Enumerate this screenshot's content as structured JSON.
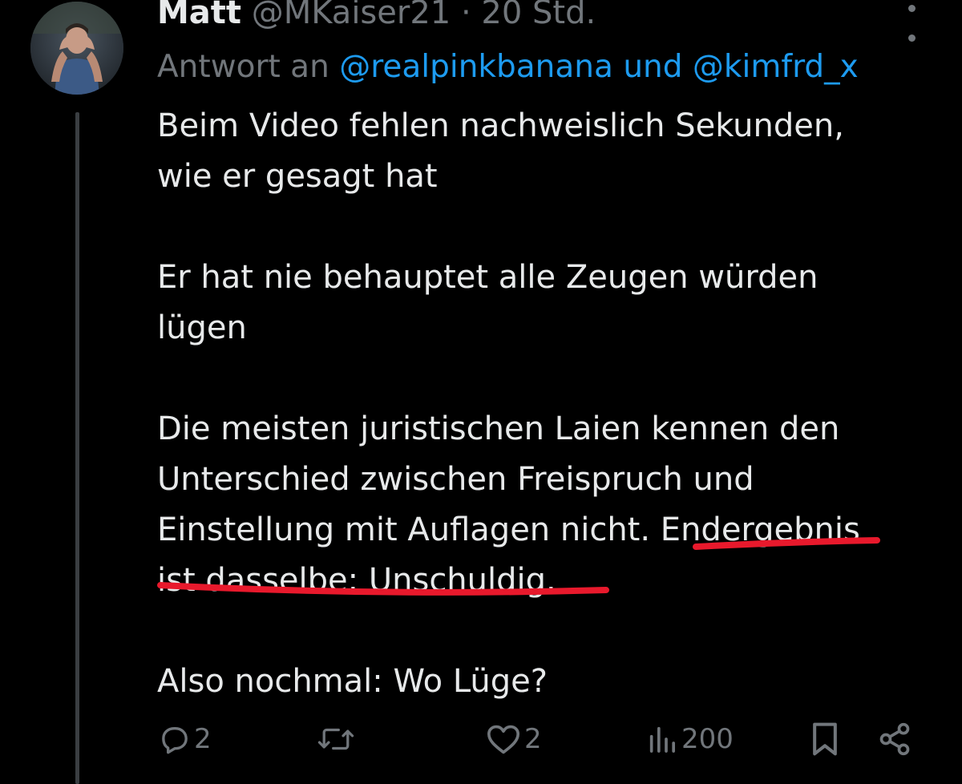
{
  "author": {
    "name": "Matt",
    "handle": "@MKaiser21",
    "separator": "·",
    "time": "20 Std."
  },
  "reply": {
    "prefix": "Antwort an",
    "mention1": "@realpinkbanana",
    "joiner": "und",
    "mention2": "@kimfrd_x"
  },
  "text": {
    "p1_l1": "Beim Video fehlen nachweislich Sekunden,",
    "p1_l2": "wie er gesagt hat",
    "p2_l1": "Er hat nie behauptet alle Zeugen würden",
    "p2_l2": "lügen",
    "p3_l1": "Die meisten juristischen Laien kennen den",
    "p3_l2": "Unterschied zwischen Freispruch und",
    "p3_l3_a": "Einstellung mit Auflagen nicht. ",
    "p3_l3_b": "Endergebnis",
    "p3_l4": "ist dasselbe: Unschuldig.",
    "p4_l1": "Also nochmal: Wo Lüge?"
  },
  "actions": {
    "replies": "2",
    "reposts": "",
    "likes": "2",
    "views": "200"
  },
  "icons": {
    "reply": "reply-icon",
    "repost": "repost-icon",
    "like": "heart-icon",
    "views": "views-icon",
    "bookmark": "bookmark-icon",
    "share": "share-icon",
    "more": "more-icon"
  },
  "colors": {
    "background": "#000000",
    "text": "#e7e9ea",
    "secondary": "#71767b",
    "link": "#1d9bf0",
    "annotation": "#e8192c"
  }
}
